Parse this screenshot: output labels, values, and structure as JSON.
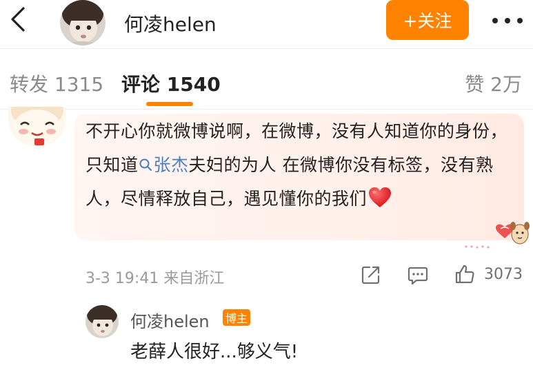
{
  "header": {
    "username": "何凌helen",
    "follow_label": "+关注"
  },
  "tabs": [
    {
      "label": "转发 1315"
    },
    {
      "label": "评论 1540"
    },
    {
      "label": "赞 2万"
    }
  ],
  "active_tab": "评论 1540",
  "comment": {
    "text_before": "不开心你就微博说啊，在微博，没有人知道你的身份，只知道",
    "mention": "张杰",
    "text_after": "夫妇的为人  在微博你没有标签，没有熟人，尽情释放自己，遇见懂你的我们",
    "emoji": "red-heart",
    "time_location": "3-3 19:41 来自浙江",
    "like_count": "3073"
  },
  "reply": {
    "username": "何凌helen",
    "badge": "博主",
    "text": "老薛人很好...够义气!"
  },
  "colors": {
    "accent": "#ff8200",
    "mention": "#4b7fbf",
    "bubble_bg": "#fff3ef"
  }
}
